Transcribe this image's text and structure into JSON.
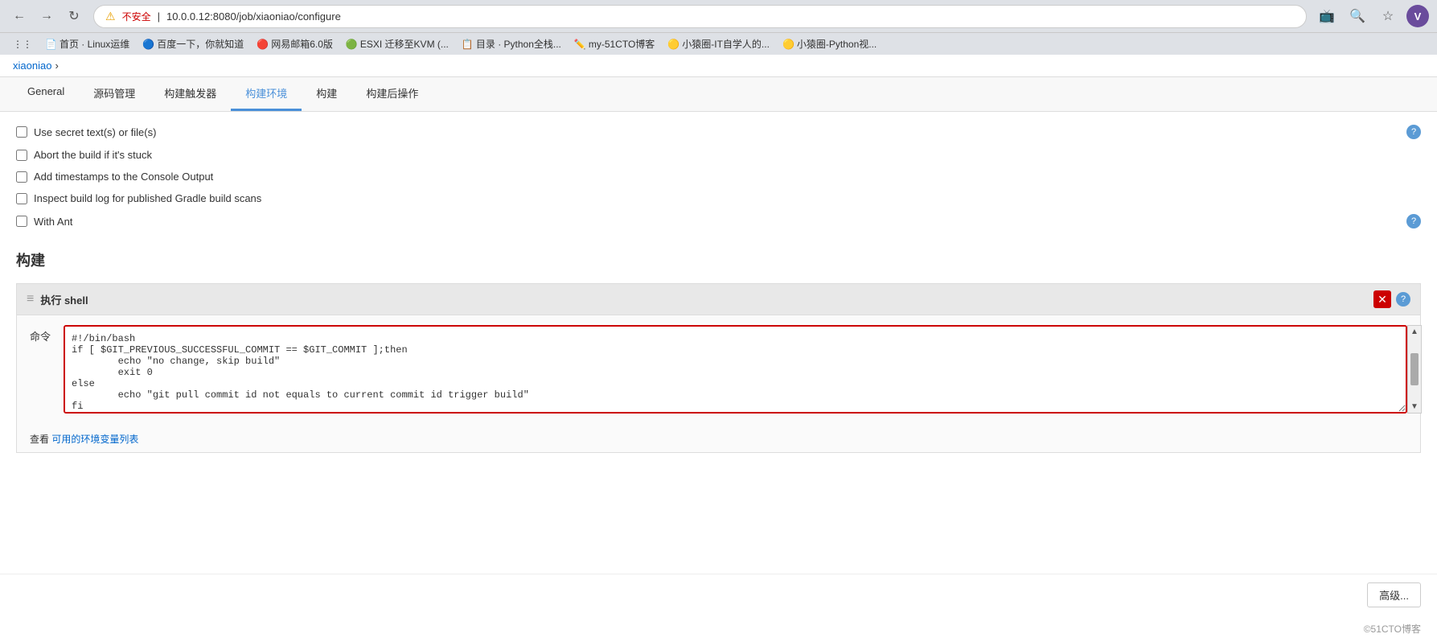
{
  "browser": {
    "url": "10.0.0.12:8080/job/xiaoniao/configure",
    "insecure_label": "不安全",
    "separator": "|",
    "user_initial": "V"
  },
  "bookmarks": [
    {
      "label": "首页 · Linux运维",
      "icon": "📄"
    },
    {
      "label": "百度一下，你就知道",
      "icon": "🔵"
    },
    {
      "label": "网易邮箱6.0版",
      "icon": "🔴"
    },
    {
      "label": "ESXI 迁移至KVM (...",
      "icon": "🟢"
    },
    {
      "label": "目录 · Python全栈...",
      "icon": "📋"
    },
    {
      "label": "my-51CTO博客",
      "icon": "✏️"
    },
    {
      "label": "小猿圈-IT自学人的...",
      "icon": "🟡"
    },
    {
      "label": "小猿圈-Python视...",
      "icon": "🟡"
    }
  ],
  "breadcrumb": {
    "items": [
      "xiaoniao",
      "›"
    ]
  },
  "tabs": [
    {
      "label": "General",
      "active": false
    },
    {
      "label": "源码管理",
      "active": false
    },
    {
      "label": "构建触发器",
      "active": false
    },
    {
      "label": "构建环境",
      "active": true
    },
    {
      "label": "构建",
      "active": false
    },
    {
      "label": "构建后操作",
      "active": false
    }
  ],
  "checkboxes": [
    {
      "label": "Use secret text(s) or file(s)",
      "checked": false,
      "has_help": true
    },
    {
      "label": "Abort the build if it's stuck",
      "checked": false,
      "has_help": false
    },
    {
      "label": "Add timestamps to the Console Output",
      "checked": false,
      "has_help": false
    },
    {
      "label": "Inspect build log for published Gradle build scans",
      "checked": false,
      "has_help": false
    },
    {
      "label": "With Ant",
      "checked": false,
      "has_help": true
    }
  ],
  "build_section": {
    "title": "构建",
    "shell_panel": {
      "title": "执行 shell",
      "command_label": "命令",
      "code_content": "#!/bin/bash\nif [ $GIT_PREVIOUS_SUCCESSFUL_COMMIT == $GIT_COMMIT ];then\n        echo \"no change, skip build\"\n        exit 0\nelse\n        echo \"git pull commit id not equals to current commit id trigger build\"\nfi",
      "env_vars_text": "查看",
      "env_vars_link_label": "可用的环境变量列表"
    }
  },
  "bottom": {
    "advanced_btn": "高级...",
    "copyright": "©51CTO博客"
  }
}
